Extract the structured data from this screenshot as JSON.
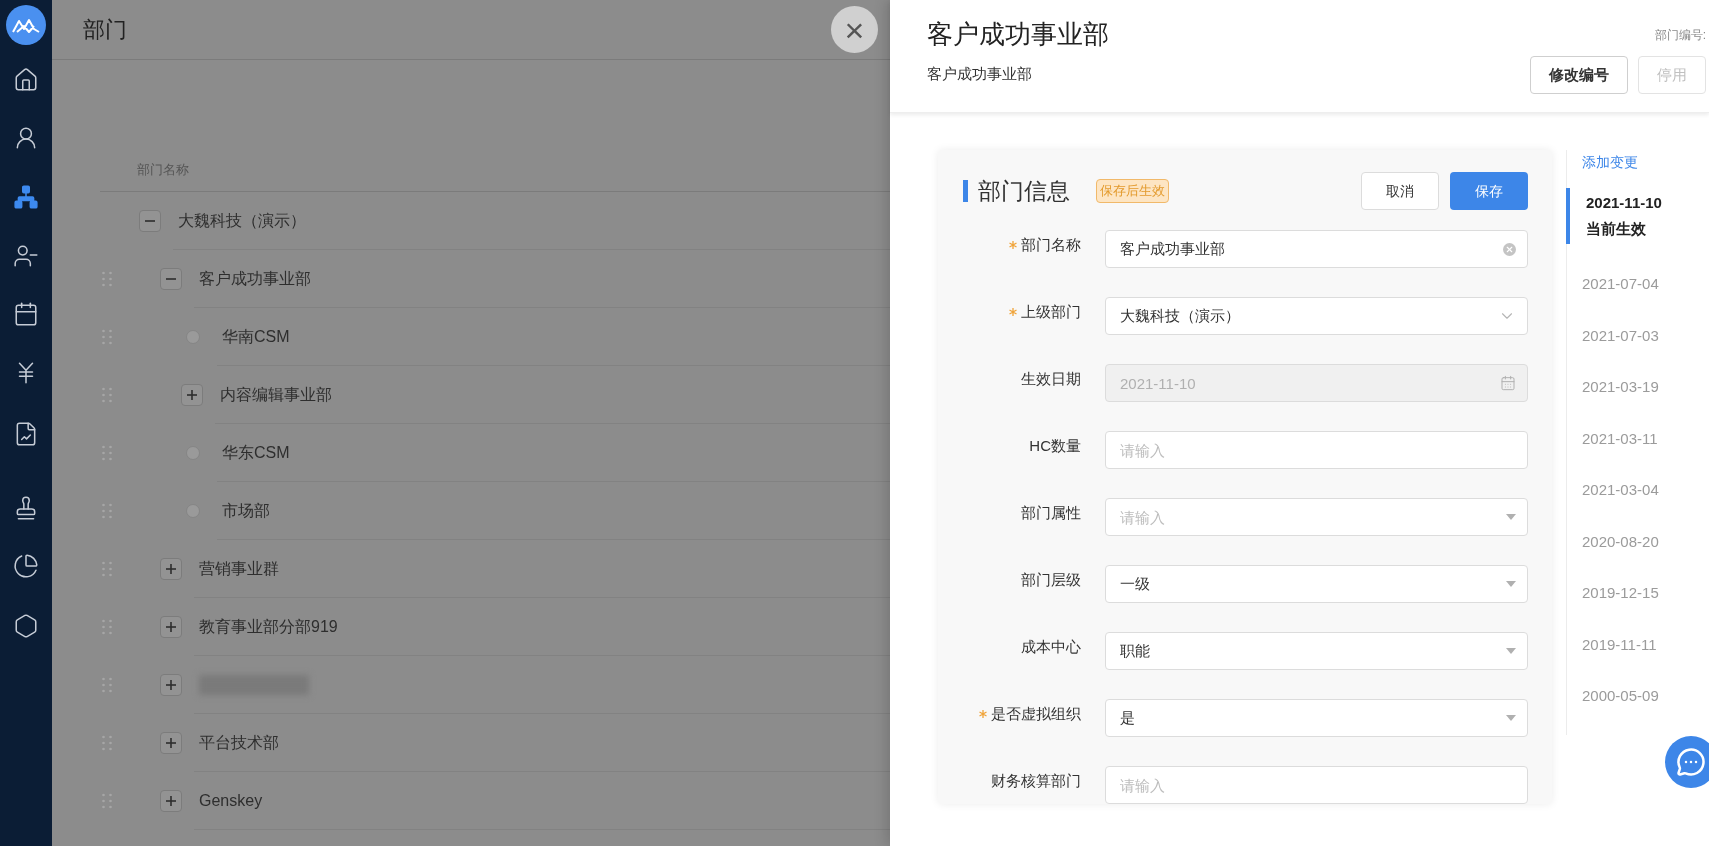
{
  "nav": [
    {
      "selected": false
    },
    {
      "selected": false
    },
    {
      "selected": false
    },
    {
      "selected": true
    },
    {
      "selected": false
    },
    {
      "selected": false
    },
    {
      "selected": false
    },
    {
      "selected": false
    },
    {
      "selected": false
    },
    {
      "selected": false
    },
    {
      "selected": false
    }
  ],
  "page": {
    "title": "部门",
    "close": "×",
    "column_header": "部门名称",
    "tree": [
      {
        "name": "大魏科技（演示）",
        "expanded": true,
        "children": [
          {
            "name": "客户成功事业部",
            "expanded": true,
            "children": [
              {
                "name": "华南CSM"
              },
              {
                "name": "内容编辑事业部",
                "expanded": false
              },
              {
                "name": "华东CSM"
              },
              {
                "name": "市场部"
              }
            ]
          },
          {
            "name": "营销事业群",
            "expanded": false
          },
          {
            "name": "教育事业部分部919",
            "expanded": false
          },
          {
            "redacted": true,
            "expanded": false
          },
          {
            "name": "平台技术部",
            "expanded": false
          },
          {
            "name": "Genskey",
            "expanded": false
          }
        ]
      }
    ]
  },
  "drawer": {
    "title": "客户成功事业部",
    "subtitle": "客户成功事业部",
    "code_label": "部门编号:",
    "buttons": [
      {
        "label": "修改编号",
        "disabled": false
      },
      {
        "label": "停用",
        "disabled": true
      }
    ],
    "card": {
      "title": "部门信息",
      "tag": "保存后生效",
      "cancel": "取消",
      "save": "保存",
      "fields": [
        {
          "label": "部门名称",
          "required": true,
          "kind": "text",
          "value": "客户成功事业部",
          "disabled": false
        },
        {
          "label": "上级部门",
          "required": true,
          "kind": "tree",
          "value": "大魏科技（演示）",
          "disabled": false
        },
        {
          "label": "生效日期",
          "required": false,
          "kind": "date",
          "value": "2021-11-10",
          "disabled": true
        },
        {
          "label": "HC数量",
          "required": false,
          "kind": "number",
          "placeholder": "请输入",
          "disabled": false
        },
        {
          "label": "部门属性",
          "required": false,
          "kind": "select",
          "placeholder": "请输入",
          "disabled": false
        },
        {
          "label": "部门层级",
          "required": false,
          "kind": "select",
          "value": "一级",
          "disabled": false
        },
        {
          "label": "成本中心",
          "required": false,
          "kind": "select",
          "value": "职能",
          "disabled": false
        },
        {
          "label": "是否虚拟组织",
          "required": true,
          "kind": "select",
          "value": "是",
          "disabled": false
        },
        {
          "label": "财务核算部门",
          "required": false,
          "kind": "number",
          "placeholder": "请输入",
          "disabled": false
        }
      ]
    },
    "timeline": {
      "add": "添加变更",
      "items": [
        {
          "date": "2021-11-10",
          "status": "当前生效",
          "selected": true
        },
        {
          "date": "2021-07-04",
          "selected": false
        },
        {
          "date": "2021-07-03",
          "selected": false
        },
        {
          "date": "2021-03-19",
          "selected": false
        },
        {
          "date": "2021-03-11",
          "selected": false
        },
        {
          "date": "2021-03-04",
          "selected": false
        },
        {
          "date": "2020-08-20",
          "selected": false
        },
        {
          "date": "2019-12-15",
          "selected": false
        },
        {
          "date": "2019-11-11",
          "selected": false
        },
        {
          "date": "2000-05-09",
          "selected": false
        }
      ]
    }
  }
}
